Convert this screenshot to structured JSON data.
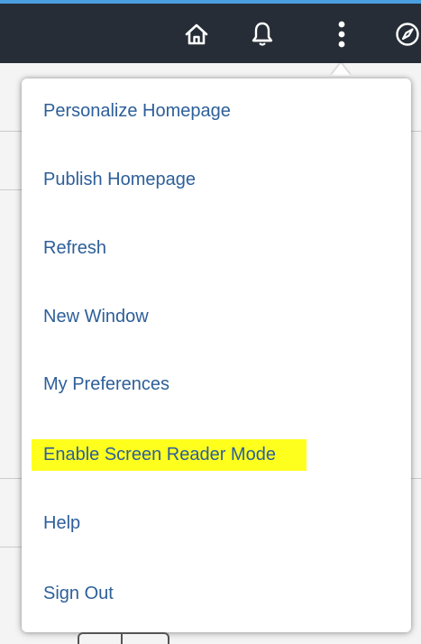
{
  "header": {
    "icons": {
      "home": "home-icon",
      "notifications": "bell-icon",
      "actions": "more-vertical-icon",
      "navbar": "compass-icon"
    },
    "colors": {
      "header_bg": "#262d36",
      "accent_stripe": "#4a9fe0"
    }
  },
  "menu": {
    "items": [
      {
        "label": "Personalize Homepage"
      },
      {
        "label": "Publish Homepage"
      },
      {
        "label": "Refresh"
      },
      {
        "label": "New Window"
      },
      {
        "label": "My Preferences"
      },
      {
        "label": "Enable Screen Reader Mode",
        "highlighted": true
      },
      {
        "label": "Help"
      },
      {
        "label": "Sign Out"
      }
    ],
    "colors": {
      "item_text": "#2d5f99",
      "highlight": "#ffff1e"
    }
  }
}
